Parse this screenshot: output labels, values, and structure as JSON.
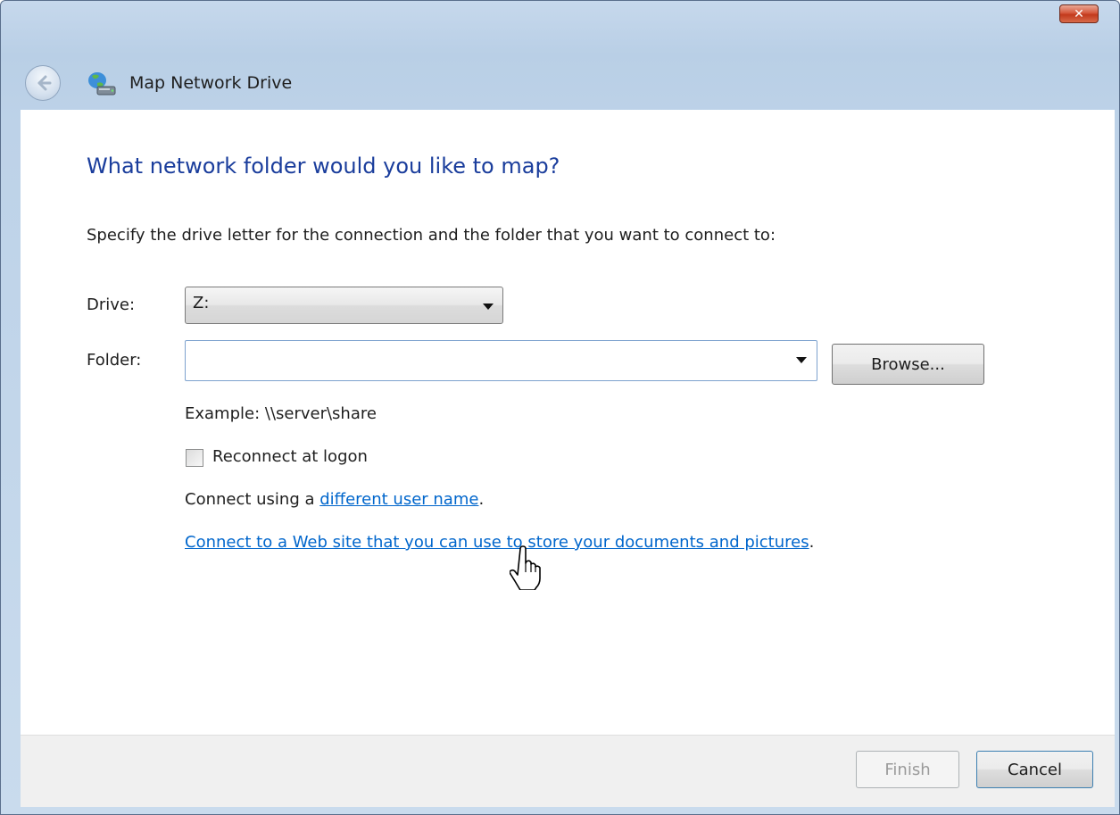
{
  "window": {
    "title": "Map Network Drive",
    "close_label": "x"
  },
  "page": {
    "heading": "What network folder would you like to map?",
    "instructions": "Specify the drive letter for the connection and the folder that you want to connect to:"
  },
  "form": {
    "drive_label": "Drive:",
    "drive_value": "Z:",
    "folder_label": "Folder:",
    "folder_value": "",
    "browse_label": "Browse...",
    "example_text": "Example: \\\\server\\share",
    "reconnect_label": "Reconnect at logon",
    "reconnect_checked": false,
    "connect_prefix": "Connect using a ",
    "different_user_link": "different user name",
    "connect_suffix": ".",
    "website_link": "Connect to a Web site that you can use to store your documents and pictures",
    "website_suffix": "."
  },
  "footer": {
    "finish_label": "Finish",
    "cancel_label": "Cancel"
  },
  "icons": {
    "back": "back-arrow-icon",
    "title": "network-drive-icon",
    "cursor": "hand-pointer-icon"
  }
}
